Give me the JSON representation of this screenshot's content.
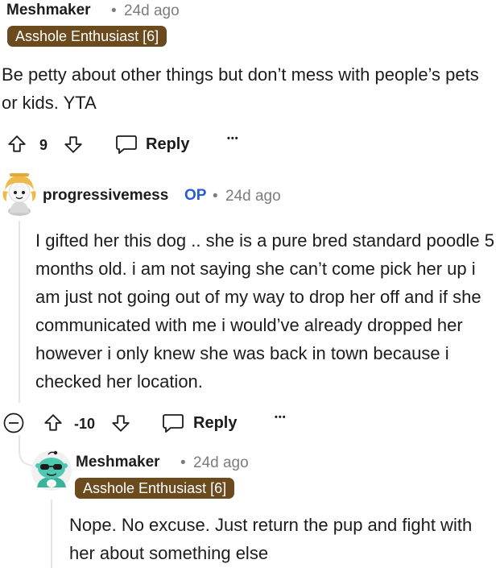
{
  "comments": [
    {
      "username": "Meshmaker",
      "timestamp": "24d ago",
      "flair": "Asshole Enthusiast [6]",
      "body": "Be petty about other things but don’t mess with people’s pets or kids. YTA",
      "votes": "9",
      "reply_label": "Reply",
      "more_label": "•••"
    },
    {
      "username": "progressivemess",
      "op_badge": "OP",
      "timestamp": "24d ago",
      "body": "I gifted her this dog .. she is a pure bred standard poodle 5 months old. i am not saying she can’t come pick her up i am just not going out of my way to drop her off and if she communicated with me i would’ve already dropped her however i only knew she was back in town because i checked her location.",
      "votes": "-10",
      "reply_label": "Reply",
      "more_label": "•••"
    },
    {
      "username": "Meshmaker",
      "timestamp": "24d ago",
      "flair": "Asshole Enthusiast [6]",
      "body": "Nope. No excuse. Just return the pup and fight with her about something else"
    }
  ],
  "separator": "•"
}
